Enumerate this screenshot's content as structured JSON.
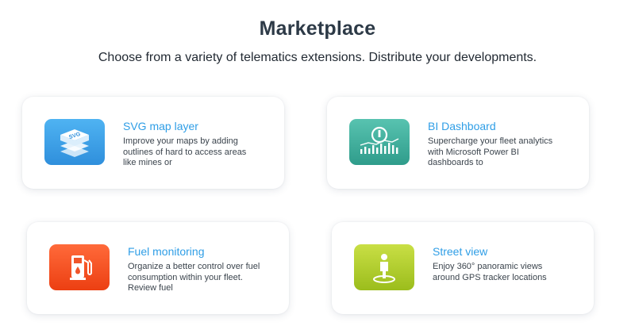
{
  "header": {
    "title": "Marketplace",
    "subtitle": "Choose from a variety of telematics extensions. Distribute your developments."
  },
  "cards": [
    {
      "title": "SVG map layer",
      "description": "Improve your maps by adding outlines of hard to access areas like mines or",
      "icon": "svg-layers-icon",
      "color": "#3a9ee6"
    },
    {
      "title": "BI Dashboard",
      "description": "Supercharge your fleet analytics with Microsoft Power BI dashboards to",
      "icon": "dashboard-chart-icon",
      "color": "#3fae9c"
    },
    {
      "title": "Fuel monitoring",
      "description": "Organize a better control over fuel consumption within your fleet. Review fuel",
      "icon": "fuel-pump-icon",
      "color": "#f24e1e"
    },
    {
      "title": "Street view",
      "description": "Enjoy 360° panoramic views around GPS tracker locations",
      "icon": "street-view-person-icon",
      "color": "#b5d02e"
    }
  ]
}
